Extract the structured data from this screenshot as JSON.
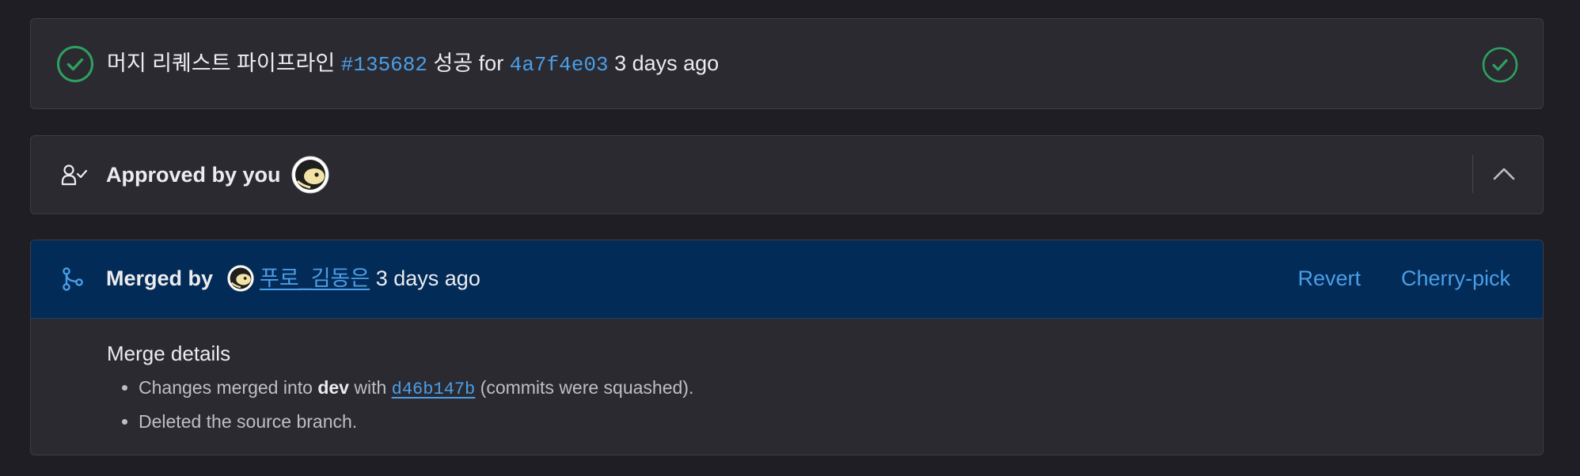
{
  "pipeline": {
    "prefix": "머지 리퀘스트 파이프라인",
    "pipeline_id": "#135682",
    "status": "성공 for",
    "commit": "4a7f4e03",
    "time": "3 days ago",
    "status_icon": "check-circle-icon",
    "success_color": "#2da160"
  },
  "approval": {
    "label": "Approved by you",
    "icon": "approval-user-check-icon",
    "toggle_icon": "chevron-up-icon"
  },
  "merge": {
    "label": "Merged by",
    "user": "푸로_김동은",
    "time": "3 days ago",
    "revert_label": "Revert",
    "cherry_pick_label": "Cherry-pick",
    "header_color": "#032b57",
    "details_title": "Merge details",
    "details": {
      "changes_prefix": "Changes merged into",
      "branch": "dev",
      "with": "with",
      "commit": "d46b147b",
      "squash_note": "(commits were squashed).",
      "deleted": "Deleted the source branch."
    }
  },
  "colors": {
    "background": "#1f1e24",
    "card": "#2b2a30",
    "link": "#4a9ee8",
    "muted_text": "#bfbfc3"
  }
}
